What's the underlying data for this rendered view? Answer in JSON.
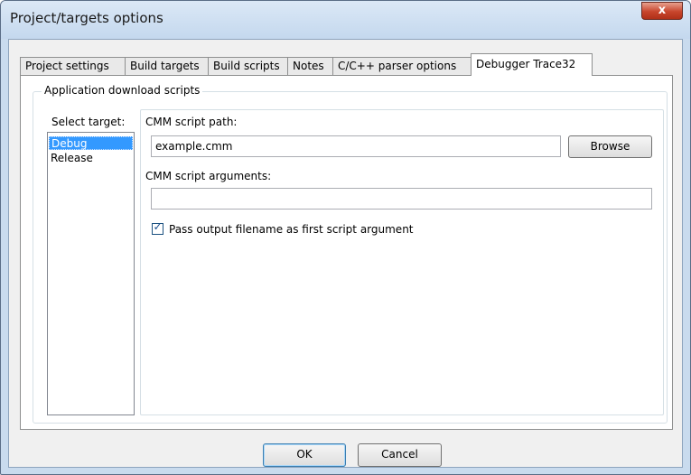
{
  "window": {
    "title": "Project/targets options",
    "close_glyph": "x"
  },
  "tabs": [
    {
      "label": "Project settings",
      "active": false
    },
    {
      "label": "Build targets",
      "active": false
    },
    {
      "label": "Build scripts",
      "active": false
    },
    {
      "label": "Notes",
      "active": false
    },
    {
      "label": "C/C++ parser options",
      "active": false
    },
    {
      "label": "Debugger Trace32",
      "active": true
    }
  ],
  "group": {
    "title": "Application download scripts",
    "select_target_label": "Select target:",
    "targets": [
      {
        "label": "Debug",
        "selected": true
      },
      {
        "label": "Release",
        "selected": false
      }
    ],
    "cmm_path_label": "CMM script path:",
    "cmm_path_value": "example.cmm",
    "browse_label": "Browse",
    "cmm_args_label": "CMM script arguments:",
    "cmm_args_value": "",
    "pass_output_checked": true,
    "pass_output_label": "Pass output filename as first script argument"
  },
  "footer": {
    "ok_label": "OK",
    "cancel_label": "Cancel"
  },
  "colors": {
    "title_bar": "#c4d8ee",
    "close_button": "#c8452c",
    "selection": "#3399ff"
  }
}
